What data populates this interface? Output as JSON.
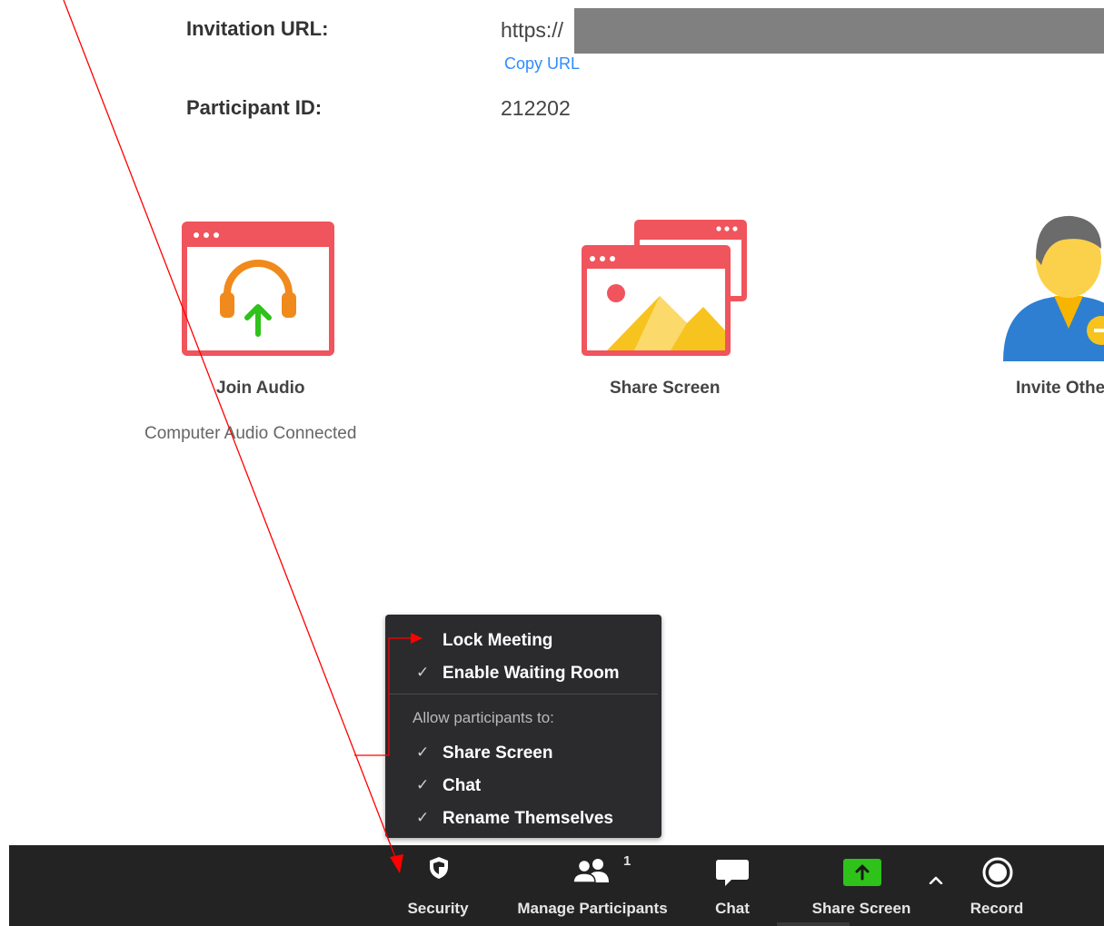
{
  "info": {
    "invitation_url_label": "Invitation URL:",
    "invitation_url_value": "https://",
    "copy_url": "Copy URL",
    "participant_id_label": "Participant ID:",
    "participant_id_value": "212202"
  },
  "actions": {
    "join_audio": "Join Audio",
    "audio_status": "Computer Audio Connected",
    "share_screen": "Share Screen",
    "invite_others": "Invite Othe"
  },
  "security_menu": {
    "lock_meeting": "Lock Meeting",
    "enable_waiting_room": "Enable Waiting Room",
    "section_label": "Allow participants to:",
    "share_screen": "Share Screen",
    "chat": "Chat",
    "rename_themselves": "Rename Themselves",
    "check_glyph": "✓"
  },
  "toolbar": {
    "security": "Security",
    "manage_participants": "Manage Participants",
    "participant_count": "1",
    "chat": "Chat",
    "share_screen": "Share Screen",
    "record": "Record"
  },
  "icons": {
    "security": "shield-icon",
    "participants": "participants-icon",
    "chat": "chat-bubble-icon",
    "share": "share-screen-arrow-icon",
    "caret": "caret-up-icon",
    "record": "record-icon",
    "join_audio": "headphones-icon",
    "share_screen_big": "share-screen-windows-icon",
    "invite": "person-invite-icon"
  },
  "colors": {
    "brand_red": "#f0545d",
    "share_green": "#2ec21a",
    "link_blue": "#2d8cff",
    "toolbar_bg": "#232323",
    "menu_bg": "#2b2b2d",
    "annotation_red": "#ff0000"
  }
}
